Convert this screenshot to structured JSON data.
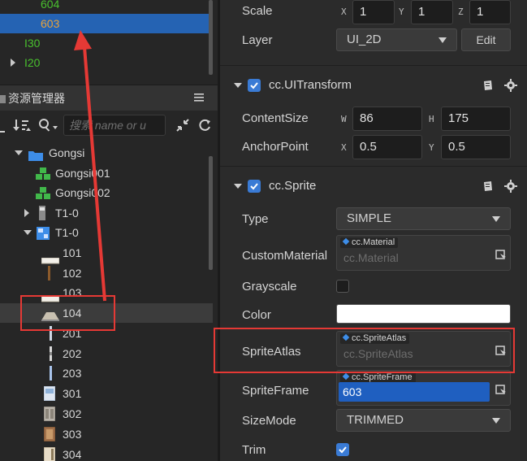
{
  "hierarchy": {
    "items": [
      {
        "label": "604"
      },
      {
        "label": "603"
      },
      {
        "label": "I30"
      },
      {
        "label": "I20"
      }
    ]
  },
  "assets": {
    "panel_title": "资源管理器",
    "search_placeholder": "搜索 name or u",
    "tree": [
      {
        "label": "Gongsi"
      },
      {
        "label": "Gongsi001"
      },
      {
        "label": "Gongsi002"
      },
      {
        "label": "T1-0"
      },
      {
        "label": "T1-0"
      },
      {
        "label": "101"
      },
      {
        "label": "102"
      },
      {
        "label": "103"
      },
      {
        "label": "104"
      },
      {
        "label": "201"
      },
      {
        "label": "202"
      },
      {
        "label": "203"
      },
      {
        "label": "301"
      },
      {
        "label": "302"
      },
      {
        "label": "303"
      },
      {
        "label": "304"
      }
    ]
  },
  "inspector": {
    "scale": {
      "label": "Scale",
      "x_axis": "X",
      "y_axis": "Y",
      "z_axis": "Z",
      "x": "1",
      "y": "1",
      "z": "1"
    },
    "layer": {
      "label": "Layer",
      "value": "UI_2D",
      "edit": "Edit"
    },
    "ui_transform": {
      "title": "cc.UITransform",
      "content_size": {
        "label": "ContentSize",
        "w_axis": "W",
        "h_axis": "H",
        "w": "86",
        "h": "175"
      },
      "anchor_point": {
        "label": "AnchorPoint",
        "x_axis": "X",
        "y_axis": "Y",
        "x": "0.5",
        "y": "0.5"
      }
    },
    "sprite": {
      "title": "cc.Sprite",
      "type": {
        "label": "Type",
        "value": "SIMPLE"
      },
      "custom_material": {
        "label": "CustomMaterial",
        "tag": "cc.Material",
        "placeholder": "cc.Material"
      },
      "grayscale": {
        "label": "Grayscale",
        "checked": false
      },
      "color": {
        "label": "Color",
        "value": "#ffffff"
      },
      "sprite_atlas": {
        "label": "SpriteAtlas",
        "tag": "cc.SpriteAtlas",
        "placeholder": "cc.SpriteAtlas"
      },
      "sprite_frame": {
        "label": "SpriteFrame",
        "tag": "cc.SpriteFrame",
        "value": "603"
      },
      "size_mode": {
        "label": "SizeMode",
        "value": "TRIMMED"
      },
      "trim": {
        "label": "Trim",
        "checked": true
      }
    }
  },
  "colors": {
    "selection": "#2563b3",
    "accent": "#3a7bd5",
    "annotation": "#e53935",
    "node_green": "#49c02e",
    "node_orange": "#e8a33a"
  }
}
